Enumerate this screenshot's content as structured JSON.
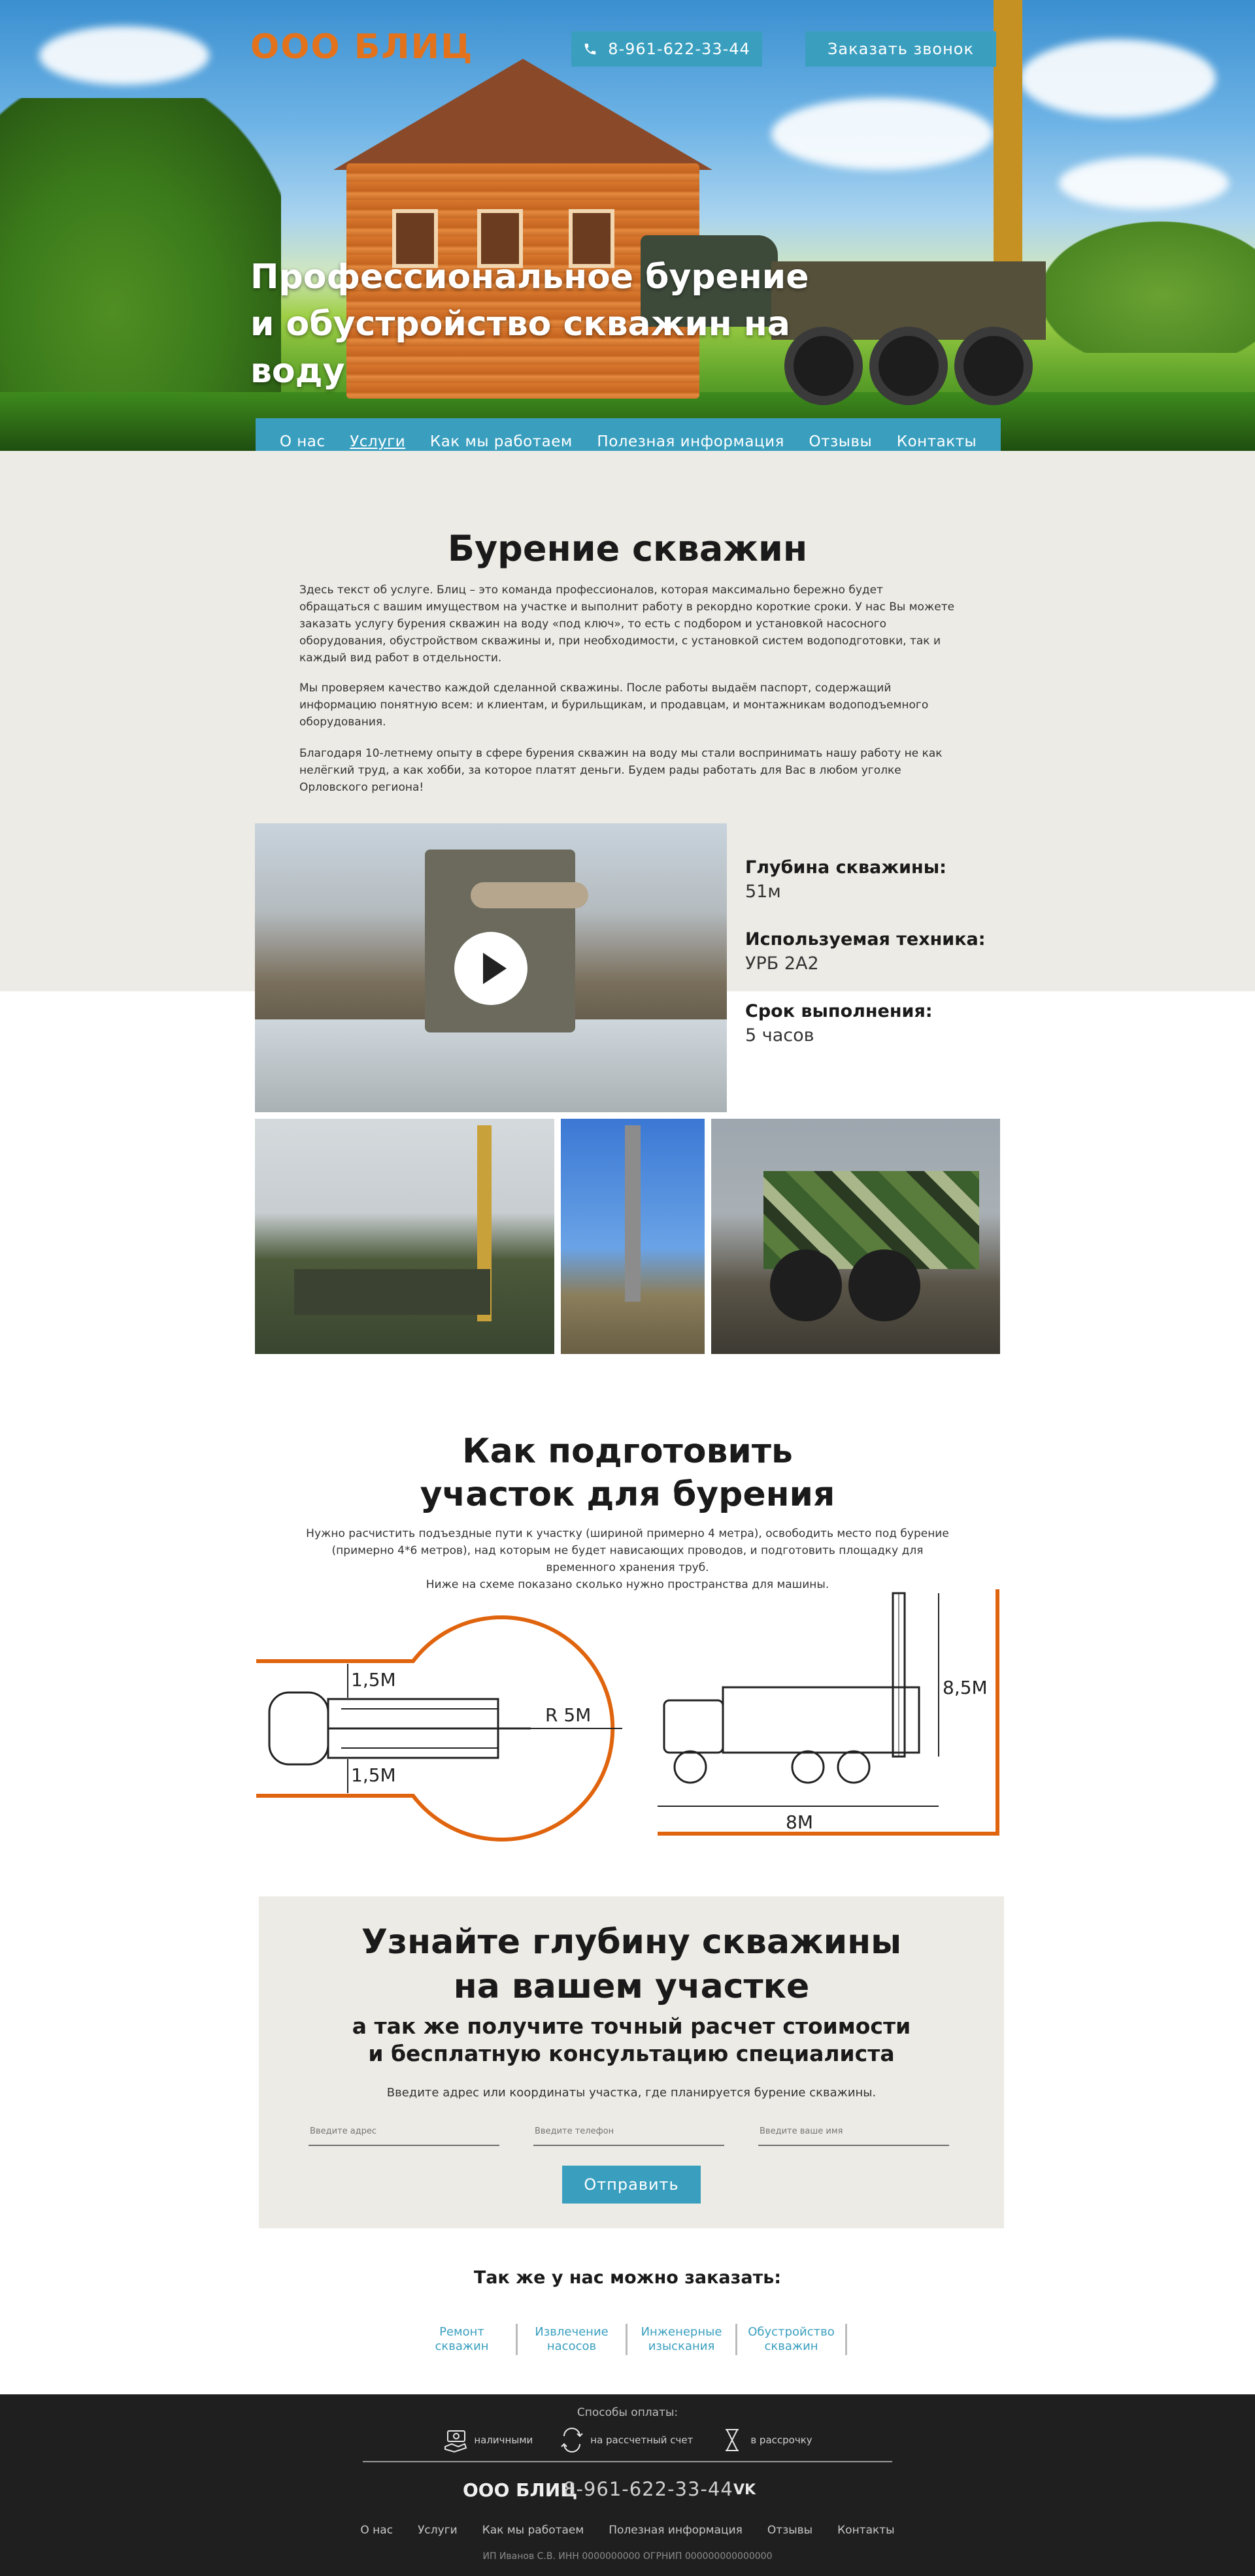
{
  "header": {
    "logo": "ООО БЛИЦ",
    "phone": "8-961-622-33-44",
    "call_button": "Заказать звонок"
  },
  "hero": {
    "title": "Профессиональное бурение и обустройство скважин на воду"
  },
  "nav": {
    "items": [
      "О нас",
      "Услуги",
      "Как мы работаем",
      "Полезная информация",
      "Отзывы",
      "Контакты"
    ],
    "active": "Услуги"
  },
  "service": {
    "title": "Бурение скважин",
    "paragraphs": [
      "Здесь текст об услуге. Блиц – это команда профессионалов, которая максимально бережно будет обращаться с вашим имуществом на участке и выполнит работу в рекордно короткие сроки. У нас Вы можете заказать услугу бурения скважин на воду «под ключ», то есть с подбором и установкой насосного оборудования, обустройством скважины и, при необходимости, с установкой систем водоподготовки, так и каждый вид работ в отдельности.",
      "Мы проверяем качество каждой сделанной скважины. После работы  выдаём паспорт, содержащий информацию понятную всем: и клиентам, и бурильщикам, и продавцам, и монтажникам водоподъемного оборудования.",
      "Благодаря 10-летнему опыту в сфере бурения скважин на воду мы стали воспринимать нашу работу не как нелёгкий труд, а как хобби, за которое платят деньги. Будем рады работать для Вас в любом уголке Орловского региона!"
    ],
    "specs": [
      {
        "label": "Глубина скважины:",
        "value": "51м"
      },
      {
        "label": "Используемая техника:",
        "value": "УРБ 2А2"
      },
      {
        "label": "Срок выполнения:",
        "value": "5 часов"
      }
    ]
  },
  "prep": {
    "title_line1": "Как подготовить",
    "title_line2": "участок для бурения",
    "text_line1": "Нужно расчистить подъездные пути к участку (шириной примерно 4 метра), освободить место под бурение",
    "text_line2": "(примерно 4*6 метров), над которым не будет нависающих проводов, и подготовить площадку для",
    "text_line3": "временного хранения труб.",
    "text_line4": "Ниже на схеме показано сколько нужно пространства для машины.",
    "scheme": {
      "top_gap": "1,5М",
      "bottom_gap": "1,5М",
      "radius": "R 5М",
      "height": "8,5М",
      "length": "8М"
    }
  },
  "depth_form": {
    "title_line1": "Узнайте глубину скважины",
    "title_line2": "на вашем участке",
    "sub_line1": "а так же получите точный расчет стоимости",
    "sub_line2": "и бесплатную консультацию специалиста",
    "note": "Введите адрес или координаты участка, где планируется бурение скважины.",
    "address_placeholder": "Введите адрес",
    "phone_placeholder": "Введите телефон",
    "name_placeholder": "Введите ваше имя",
    "submit": "Отправить"
  },
  "also": {
    "title": "Так же у нас можно заказать:",
    "links": [
      {
        "line1": "Ремонт",
        "line2": "скважин"
      },
      {
        "line1": "Извлечение",
        "line2": "насосов"
      },
      {
        "line1": "Инженерные",
        "line2": "изыскания"
      },
      {
        "line1": "Обустройство",
        "line2": "скважин"
      }
    ]
  },
  "footer": {
    "pay_title": "Способы оплаты:",
    "pay_methods": [
      "наличными",
      "на рассчетный счет",
      "в рассрочку"
    ],
    "logo": "ООО БЛИЦ",
    "phone": "8-961-622-33-44",
    "vk": "VK",
    "nav": [
      "О нас",
      "Услуги",
      "Как мы работаем",
      "Полезная информация",
      "Отзывы",
      "Контакты"
    ],
    "legal": "ИП Иванов С.В. ИНН 0000000000 ОГРНИП 000000000000000"
  },
  "colors": {
    "accent": "#3a9fbf",
    "logo": "#e3721c",
    "scheme_line": "#e0640d",
    "grey_band": "#ecebe5",
    "footer": "#1f1f1f"
  }
}
